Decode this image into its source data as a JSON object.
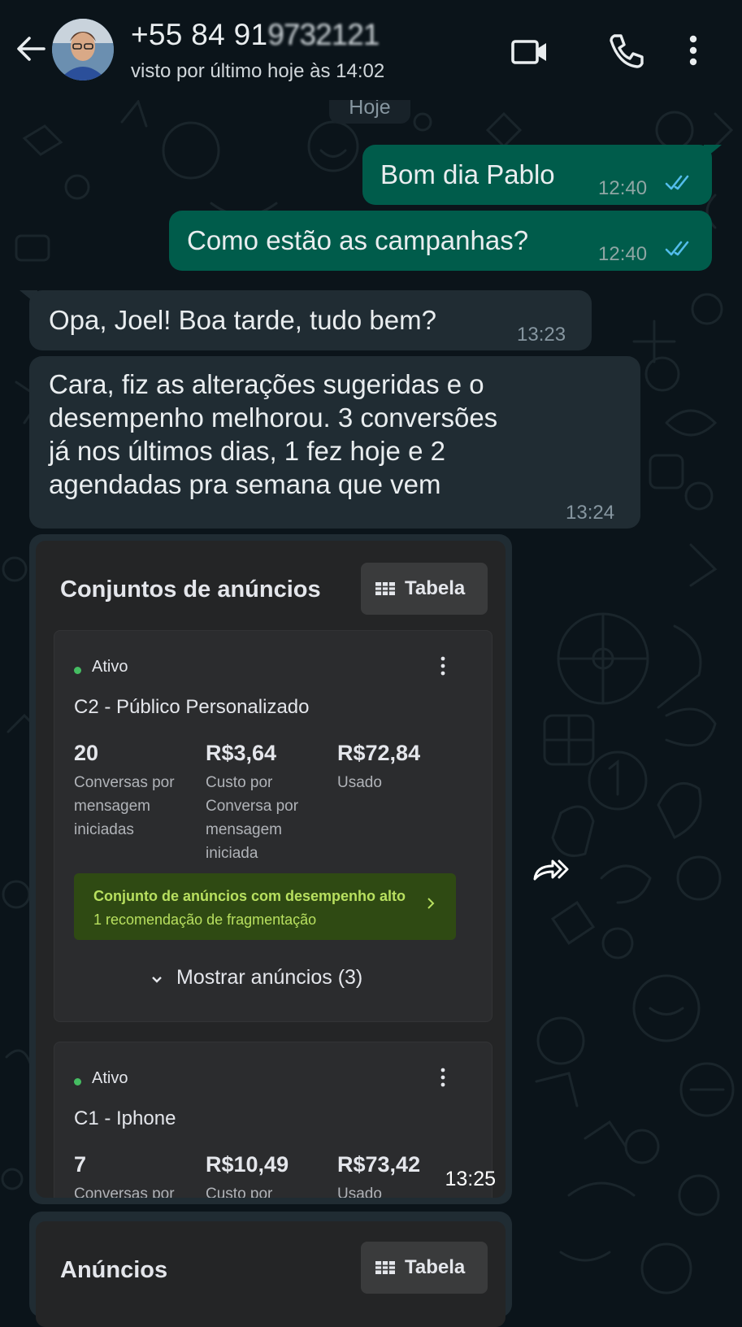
{
  "header": {
    "contact_visible": "+55 84 91",
    "contact_obscured": "9732121",
    "status": "visto por último hoje às 14:02"
  },
  "chat": {
    "date_chip": "Hoje",
    "messages": [
      {
        "direction": "out",
        "text": "Bom dia Pablo",
        "time": "12:40",
        "read": true
      },
      {
        "direction": "out",
        "text": "Como estão as campanhas?",
        "time": "12:40",
        "read": true
      },
      {
        "direction": "in",
        "text": "Opa, Joel! Boa tarde, tudo bem?",
        "time": "13:23"
      },
      {
        "direction": "in",
        "lines": [
          "Cara, fiz as alterações sugeridas e o",
          "desempenho melhorou. 3 conversões",
          "já nos últimos dias, 1 fez hoje e 2",
          "agendadas pra semana que vem"
        ],
        "time": "13:24"
      }
    ],
    "image_message": {
      "time": "13:25",
      "section_title": "Conjuntos de anúncios",
      "table_button": "Tabela",
      "adsets": [
        {
          "status": "Ativo",
          "name": "C2 - Público Personalizado",
          "metrics": [
            {
              "value": "20",
              "label_lines": [
                "Conversas por",
                "mensagem",
                "iniciadas"
              ]
            },
            {
              "value": "R$3,64",
              "label_lines": [
                "Custo por",
                "Conversa por",
                "mensagem",
                "iniciada"
              ]
            },
            {
              "value": "R$72,84",
              "label_lines": [
                "Usado"
              ]
            }
          ],
          "recommendation": {
            "title": "Conjunto de anúncios com desempenho alto",
            "subtitle": "1 recomendação de fragmentação"
          },
          "show_ads": "Mostrar anúncios (3)"
        },
        {
          "status": "Ativo",
          "name": "C1 - Iphone",
          "metrics": [
            {
              "value": "7",
              "label_lines": [
                "Conversas por"
              ]
            },
            {
              "value": "R$10,49",
              "label_lines": [
                "Custo por"
              ]
            },
            {
              "value": "R$73,42",
              "label_lines": [
                "Usado"
              ]
            }
          ]
        }
      ]
    },
    "image_message_2": {
      "section_title": "Anúncios",
      "table_button": "Tabela"
    }
  },
  "colors": {
    "background": "#0b141a",
    "outgoing_bubble": "#005c4b",
    "incoming_bubble": "#202c33",
    "read_ticks": "#53bdeb",
    "active_dot": "#45bd62",
    "recommendation_bg": "#2f4a13",
    "recommendation_text": "#b8e05f"
  },
  "icons": [
    "back-arrow-icon",
    "video-call-icon",
    "phone-icon",
    "more-vert-icon",
    "double-check-icon",
    "table-icon",
    "kebab-icon",
    "chevron-right-icon",
    "chevron-down-icon",
    "forward-icon"
  ]
}
